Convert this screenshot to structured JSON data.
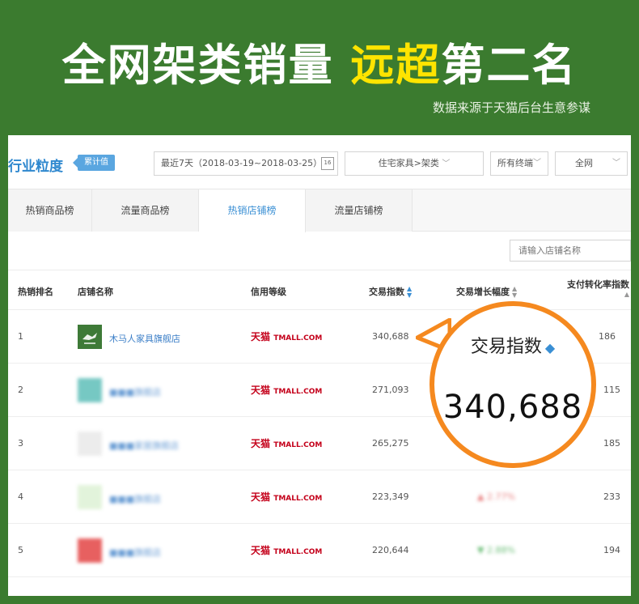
{
  "headline": {
    "part1": "全网架类销量",
    "part2": "远超",
    "part3": "第二名"
  },
  "source": "数据来源于天猫后台生意参谋",
  "filters": {
    "industry": "行业粒度",
    "badge": "累计值",
    "date_range": "最近7天（2018-03-19~2018-03-25）",
    "calendar_day": "16",
    "category": "住宅家具>架类",
    "terminal": "所有终端",
    "scope": "全网"
  },
  "tabs": [
    "热销商品榜",
    "流量商品榜",
    "热销店铺榜",
    "流量店铺榜"
  ],
  "active_tab": 2,
  "search_placeholder": "请输入店铺名称",
  "columns": {
    "rank": "热销排名",
    "store": "店铺名称",
    "credit": "信用等级",
    "trade_index": "交易指数",
    "growth": "交易增长幅度",
    "conversion": "支付转化率指数"
  },
  "platform_label": {
    "cn": "天猫",
    "en": "TMALL.COM"
  },
  "rows": [
    {
      "rank": "1",
      "store": "木马人家具旗舰店",
      "trade_index": "340,688",
      "growth": "",
      "conversion": "186",
      "logo_color": "#3e7a37"
    },
    {
      "rank": "2",
      "store": "■■■旗舰店",
      "trade_index": "271,093",
      "growth": "",
      "conversion": "115",
      "logo_color": "#49b6b0"
    },
    {
      "rank": "3",
      "store": "■■■家居旗舰店",
      "trade_index": "265,275",
      "growth": "",
      "conversion": "185",
      "logo_color": "#c9c9c9"
    },
    {
      "rank": "4",
      "store": "■■■旗舰店",
      "trade_index": "223,349",
      "growth": "2.77%",
      "conversion": "233",
      "logo_color": "#8fcf7a"
    },
    {
      "rank": "5",
      "store": "■■■旗舰店",
      "trade_index": "220,644",
      "growth": "2.88%",
      "conversion": "194",
      "logo_color": "#e02c2c"
    }
  ],
  "callout": {
    "label": "交易指数",
    "value": "340,688"
  },
  "colors": {
    "background": "#3b7b2f",
    "highlight": "#ffe400",
    "accent": "#f5891f",
    "link": "#3a7ec7"
  }
}
